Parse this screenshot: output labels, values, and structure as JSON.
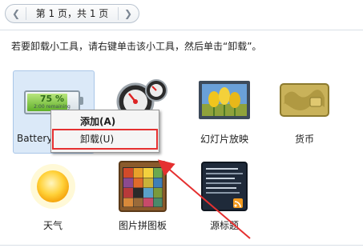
{
  "pager": {
    "text": "第 1 页，共 1 页",
    "prev_icon": "chevron-left-icon",
    "next_icon": "chevron-right-icon"
  },
  "hint": "若要卸载小工具，请右键单击该小工具，然后单击“卸载”。",
  "gadgets": [
    {
      "name": "Battery",
      "battery_percent": "75 %",
      "battery_level": 0.75,
      "battery_remaining": "2:00 remaining"
    },
    {
      "name": "CPU"
    },
    {
      "name": "幻灯片放映"
    },
    {
      "name": "货币"
    },
    {
      "name": "天气"
    },
    {
      "name": "图片拼图板"
    },
    {
      "name": "源标题"
    }
  ],
  "context_menu": {
    "add": "添加(A)",
    "uninstall": "卸载(U)"
  },
  "colors": {
    "highlight_box": "#e53030",
    "arrow": "#e53030",
    "selection_bg": "#dbe9f8"
  }
}
